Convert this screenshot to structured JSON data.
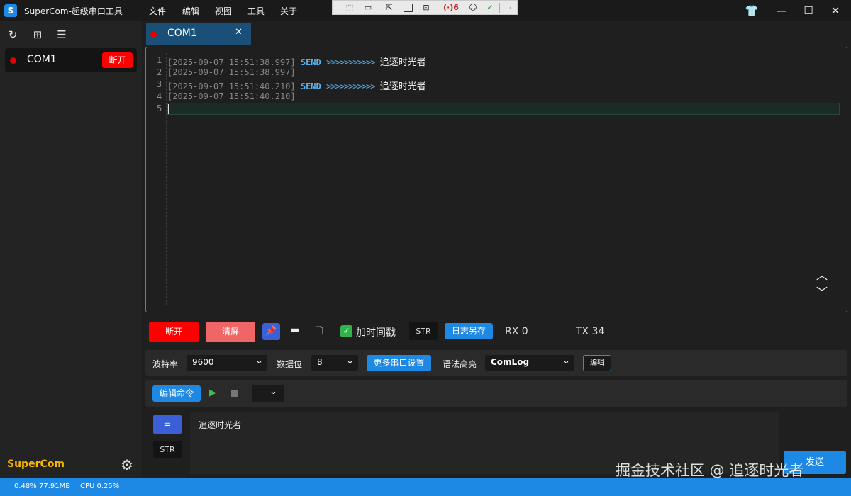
{
  "app": {
    "title": "SuperCom-超级串口工具",
    "icon_letter": "S"
  },
  "menu": [
    "文件",
    "编辑",
    "视图",
    "工具",
    "关于"
  ],
  "float_toolbar": {
    "badge": "(·)6"
  },
  "sidebar": {
    "item": {
      "label": "COM1",
      "disconnect_label": "断开",
      "status_color": "#e80000"
    },
    "brand": "SuperCom"
  },
  "tab": {
    "label": "COM1"
  },
  "log": {
    "lines": [
      {
        "num": "1",
        "time": "[2025-09-07 15:51:38.997]",
        "dir": "SEND",
        "arrows": ">>>>>>>>>>>",
        "msg": "追逐时光者"
      },
      {
        "num": "2",
        "time": "[2025-09-07 15:51:38.997]",
        "dir": "",
        "arrows": "",
        "msg": ""
      },
      {
        "num": "3",
        "time": "[2025-09-07 15:51:40.210]",
        "dir": "SEND",
        "arrows": ">>>>>>>>>>>",
        "msg": "追逐时光者"
      },
      {
        "num": "4",
        "time": "[2025-09-07 15:51:40.210]",
        "dir": "",
        "arrows": "",
        "msg": ""
      },
      {
        "num": "5",
        "time": "",
        "dir": "",
        "arrows": "",
        "msg": ""
      }
    ]
  },
  "toolbar": {
    "disconnect": "断开",
    "clear": "清屏",
    "timestamp_label": "加时间戳",
    "format": "STR",
    "save_log": "日志另存",
    "rx": "RX 0",
    "tx": "TX 34"
  },
  "settings": {
    "baud_label": "波特率",
    "baud_value": "9600",
    "databits_label": "数据位",
    "databits_value": "8",
    "more_settings": "更多串口设置",
    "syntax_label": "语法高亮",
    "syntax_value": "ComLog",
    "edit": "编辑"
  },
  "command": {
    "edit_label": "编辑命令",
    "select_value": ""
  },
  "input": {
    "text": "追逐时光者",
    "format": "STR",
    "send_label": "发送"
  },
  "watermark": "掘金技术社区 @ 追逐时光者",
  "status": {
    "mem": "0.48% 77.91MB",
    "cpu": "CPU 0.25%"
  },
  "colors": {
    "accent": "#1e88e5",
    "danger": "#ff0000",
    "brand": "#f5b800",
    "send": "#5ab4f0"
  }
}
